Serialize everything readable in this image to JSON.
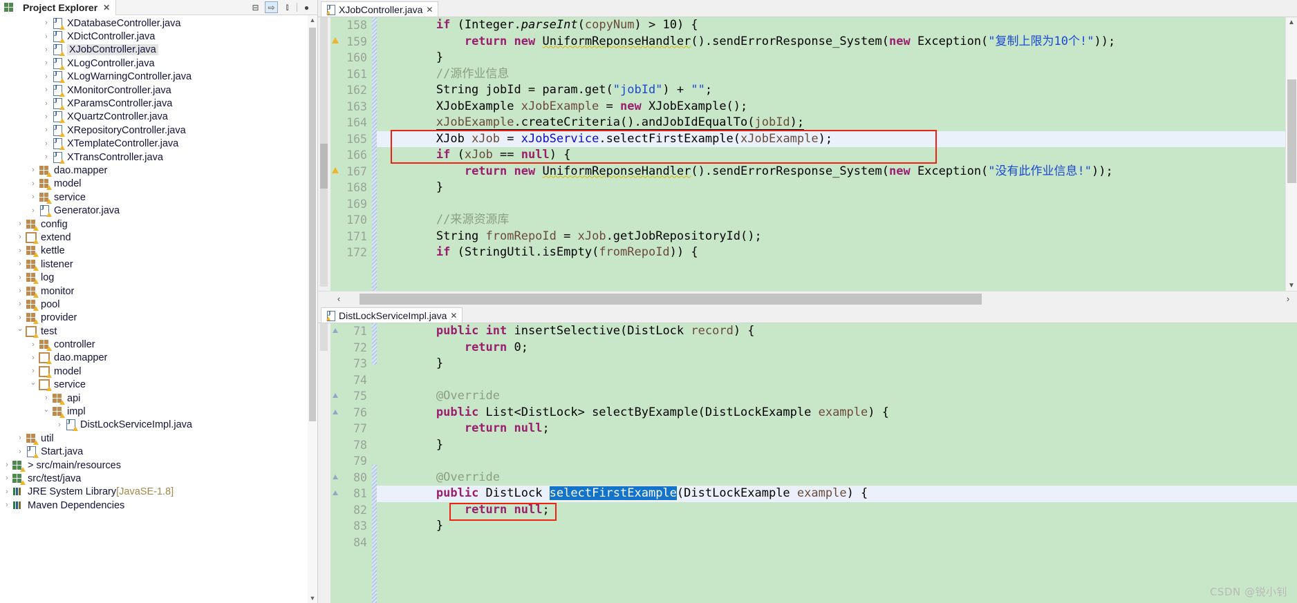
{
  "explorer": {
    "tab_label": "Project Explorer",
    "close_icon": "✕",
    "toolbar": [
      {
        "name": "collapse-all-icon",
        "glyph": "⊟"
      },
      {
        "name": "link-with-editor-icon",
        "glyph": "⇨"
      },
      {
        "name": "view-menu-icon",
        "glyph": "⫾"
      },
      {
        "name": "minimize-icon",
        "glyph": "●"
      }
    ],
    "tree": [
      {
        "label": "XDatabaseController.java",
        "indent": 5,
        "twisty": "closed",
        "icon": "java",
        "warn": true
      },
      {
        "label": "XDictController.java",
        "indent": 5,
        "twisty": "closed",
        "icon": "java",
        "warn": true
      },
      {
        "label": "XJobController.java",
        "indent": 5,
        "twisty": "closed",
        "icon": "java",
        "warn": true,
        "selected": true
      },
      {
        "label": "XLogController.java",
        "indent": 5,
        "twisty": "closed",
        "icon": "java",
        "warn": true
      },
      {
        "label": "XLogWarningController.java",
        "indent": 5,
        "twisty": "closed",
        "icon": "java",
        "warn": true
      },
      {
        "label": "XMonitorController.java",
        "indent": 5,
        "twisty": "closed",
        "icon": "java",
        "warn": true
      },
      {
        "label": "XParamsController.java",
        "indent": 5,
        "twisty": "closed",
        "icon": "java",
        "warn": true
      },
      {
        "label": "XQuartzController.java",
        "indent": 5,
        "twisty": "closed",
        "icon": "java",
        "warn": true
      },
      {
        "label": "XRepositoryController.java",
        "indent": 5,
        "twisty": "closed",
        "icon": "java",
        "warn": true
      },
      {
        "label": "XTemplateController.java",
        "indent": 5,
        "twisty": "closed",
        "icon": "java",
        "warn": true
      },
      {
        "label": "XTransController.java",
        "indent": 5,
        "twisty": "closed",
        "icon": "java",
        "warn": true
      },
      {
        "label": "dao.mapper",
        "indent": 4,
        "twisty": "closed",
        "icon": "pkg",
        "warn": true
      },
      {
        "label": "model",
        "indent": 4,
        "twisty": "closed",
        "icon": "pkg",
        "warn": true
      },
      {
        "label": "service",
        "indent": 4,
        "twisty": "closed",
        "icon": "pkg",
        "warn": true
      },
      {
        "label": "Generator.java",
        "indent": 4,
        "twisty": "closed",
        "icon": "java",
        "warn": true
      },
      {
        "label": "config",
        "indent": 3,
        "twisty": "closed",
        "icon": "pkg",
        "warn": true
      },
      {
        "label": "extend",
        "indent": 3,
        "twisty": "closed",
        "icon": "pkgempty",
        "warn": true
      },
      {
        "label": "kettle",
        "indent": 3,
        "twisty": "closed",
        "icon": "pkg",
        "warn": true
      },
      {
        "label": "listener",
        "indent": 3,
        "twisty": "closed",
        "icon": "pkg",
        "warn": true
      },
      {
        "label": "log",
        "indent": 3,
        "twisty": "closed",
        "icon": "pkg",
        "warn": true
      },
      {
        "label": "monitor",
        "indent": 3,
        "twisty": "closed",
        "icon": "pkg",
        "warn": true
      },
      {
        "label": "pool",
        "indent": 3,
        "twisty": "closed",
        "icon": "pkg",
        "warn": true
      },
      {
        "label": "provider",
        "indent": 3,
        "twisty": "closed",
        "icon": "pkg",
        "warn": true
      },
      {
        "label": "test",
        "indent": 3,
        "twisty": "open",
        "icon": "pkgempty",
        "warn": true
      },
      {
        "label": "controller",
        "indent": 4,
        "twisty": "closed",
        "icon": "pkg",
        "warn": true
      },
      {
        "label": "dao.mapper",
        "indent": 4,
        "twisty": "closed",
        "icon": "pkgempty",
        "warn": true
      },
      {
        "label": "model",
        "indent": 4,
        "twisty": "closed",
        "icon": "pkgempty",
        "warn": true
      },
      {
        "label": "service",
        "indent": 4,
        "twisty": "open",
        "icon": "pkgempty",
        "warn": true
      },
      {
        "label": "api",
        "indent": 5,
        "twisty": "closed",
        "icon": "pkg",
        "warn": true
      },
      {
        "label": "impl",
        "indent": 5,
        "twisty": "open",
        "icon": "pkg",
        "warn": true
      },
      {
        "label": "DistLockServiceImpl.java",
        "indent": 6,
        "twisty": "closed",
        "icon": "java",
        "warn": true
      },
      {
        "label": "util",
        "indent": 3,
        "twisty": "closed",
        "icon": "pkg",
        "warn": true
      },
      {
        "label": "Start.java",
        "indent": 3,
        "twisty": "closed",
        "icon": "java",
        "warn": true
      },
      {
        "label": "> src/main/resources",
        "indent": 2,
        "twisty": "closed",
        "icon": "srcfolder",
        "warn": true
      },
      {
        "label": "src/test/java",
        "indent": 2,
        "twisty": "closed",
        "icon": "srcfolder",
        "warn": true
      },
      {
        "label": "JRE System Library",
        "suffix": " [JavaSE-1.8]",
        "indent": 2,
        "twisty": "closed",
        "icon": "lib",
        "warn": false
      },
      {
        "label": "Maven Dependencies",
        "indent": 2,
        "twisty": "closed",
        "icon": "lib",
        "warn": false
      }
    ]
  },
  "editor_top": {
    "tab_label": "XJobController.java",
    "close_icon": "✕",
    "first_line": 158,
    "lines": [
      {
        "n": 158,
        "segs": [
          {
            "t": "        "
          },
          {
            "t": "if",
            "c": "kw"
          },
          {
            "t": " (Integer."
          },
          {
            "t": "parseInt",
            "c": "mitalic"
          },
          {
            "t": "("
          },
          {
            "t": "copyNum",
            "c": "loc"
          },
          {
            "t": ") > 10) {"
          }
        ]
      },
      {
        "n": 158.1,
        "warn": true,
        "n_disp": 159,
        "segs": [
          {
            "t": "            "
          },
          {
            "t": "return",
            "c": "kw"
          },
          {
            "t": " "
          },
          {
            "t": "new",
            "c": "kw"
          },
          {
            "t": " "
          },
          {
            "t": "UniformReponseHandler",
            "c": "ul-warn"
          },
          {
            "t": "().sendErrorResponse_System("
          },
          {
            "t": "new",
            "c": "kw"
          },
          {
            "t": " Exception("
          },
          {
            "t": "\"复制上限为10个!\"",
            "c": "str"
          },
          {
            "t": "));"
          }
        ]
      },
      {
        "n": 160,
        "segs": [
          {
            "t": "        }"
          }
        ]
      },
      {
        "n": 161,
        "segs": [
          {
            "t": "        //源作业信息",
            "c": "cmt"
          }
        ]
      },
      {
        "n": 162,
        "segs": [
          {
            "t": "        String jobId = param.get("
          },
          {
            "t": "\"jobId\"",
            "c": "str"
          },
          {
            "t": ") + "
          },
          {
            "t": "\"\"",
            "c": "str"
          },
          {
            "t": ";"
          }
        ]
      },
      {
        "n": 163,
        "segs": [
          {
            "t": "        XJobExample "
          },
          {
            "t": "xJobExample",
            "c": "loc"
          },
          {
            "t": " = "
          },
          {
            "t": "new",
            "c": "kw"
          },
          {
            "t": " XJobExample();"
          }
        ]
      },
      {
        "n": 164,
        "segs": [
          {
            "t": "        "
          },
          {
            "t": "xJobExample",
            "c": "loc ul-link"
          },
          {
            "t": ".createCriteria().andJobIdEqualTo(",
            "c": "ul-link"
          },
          {
            "t": "jobId",
            "c": "loc ul-link"
          },
          {
            "t": ");",
            "c": "ul-link"
          }
        ]
      },
      {
        "n": 165,
        "current": true,
        "segs": [
          {
            "t": "        XJob "
          },
          {
            "t": "xJob",
            "c": "loc"
          },
          {
            "t": " = "
          },
          {
            "t": "xJobService",
            "c": "fld"
          },
          {
            "t": ".selectFirstExample("
          },
          {
            "t": "xJobExample",
            "c": "loc"
          },
          {
            "t": ");"
          }
        ]
      },
      {
        "n": 166,
        "segs": [
          {
            "t": "        "
          },
          {
            "t": "if",
            "c": "kw"
          },
          {
            "t": " ("
          },
          {
            "t": "xJob",
            "c": "loc"
          },
          {
            "t": " == "
          },
          {
            "t": "null",
            "c": "kw"
          },
          {
            "t": ") {"
          }
        ]
      },
      {
        "n": 167,
        "warn": true,
        "segs": [
          {
            "t": "            "
          },
          {
            "t": "return",
            "c": "kw"
          },
          {
            "t": " "
          },
          {
            "t": "new",
            "c": "kw"
          },
          {
            "t": " "
          },
          {
            "t": "UniformReponseHandler",
            "c": "ul-warn"
          },
          {
            "t": "().sendErrorResponse_System("
          },
          {
            "t": "new",
            "c": "kw"
          },
          {
            "t": " Exception("
          },
          {
            "t": "\"没有此作业信息!\"",
            "c": "str"
          },
          {
            "t": "));"
          }
        ]
      },
      {
        "n": 168,
        "segs": [
          {
            "t": "        }"
          }
        ]
      },
      {
        "n": 169,
        "segs": [
          {
            "t": ""
          }
        ]
      },
      {
        "n": 170,
        "segs": [
          {
            "t": "        //来源资源库",
            "c": "cmt"
          }
        ]
      },
      {
        "n": 171,
        "segs": [
          {
            "t": "        String "
          },
          {
            "t": "fromRepoId",
            "c": "loc"
          },
          {
            "t": " = "
          },
          {
            "t": "xJob",
            "c": "loc"
          },
          {
            "t": ".getJobRepositoryId();"
          }
        ]
      },
      {
        "n": 172,
        "clipped": true,
        "segs": [
          {
            "t": "        "
          },
          {
            "t": "if",
            "c": "kw"
          },
          {
            "t": " (StringUtil.isEmpty("
          },
          {
            "t": "fromRepoId",
            "c": "loc"
          },
          {
            "t": ")) {"
          }
        ]
      }
    ],
    "hscroll": {
      "left_arrow": "‹",
      "right_arrow": "›"
    }
  },
  "editor_bottom": {
    "tab_label": "DistLockServiceImpl.java",
    "close_icon": "✕",
    "lines": [
      {
        "n": 71,
        "fold": true,
        "segs": [
          {
            "t": "        "
          },
          {
            "t": "public",
            "c": "kw"
          },
          {
            "t": " "
          },
          {
            "t": "int",
            "c": "kw"
          },
          {
            "t": " insertSelective(DistLock "
          },
          {
            "t": "record",
            "c": "loc"
          },
          {
            "t": ") {"
          }
        ]
      },
      {
        "n": 72,
        "segs": [
          {
            "t": "            "
          },
          {
            "t": "return",
            "c": "kw"
          },
          {
            "t": " 0;"
          }
        ]
      },
      {
        "n": 73,
        "segs": [
          {
            "t": "        }"
          }
        ]
      },
      {
        "n": 74,
        "segs": [
          {
            "t": ""
          }
        ]
      },
      {
        "n": 75,
        "fold": true,
        "segs": [
          {
            "t": "        "
          },
          {
            "t": "@Override",
            "c": "anno"
          }
        ]
      },
      {
        "n": 76,
        "fold": true,
        "segs": [
          {
            "t": "        "
          },
          {
            "t": "public",
            "c": "kw"
          },
          {
            "t": " List<DistLock> selectByExample(DistLockExample "
          },
          {
            "t": "example",
            "c": "loc"
          },
          {
            "t": ") {"
          }
        ]
      },
      {
        "n": 77,
        "segs": [
          {
            "t": "            "
          },
          {
            "t": "return",
            "c": "kw"
          },
          {
            "t": " "
          },
          {
            "t": "null",
            "c": "kw"
          },
          {
            "t": ";"
          }
        ]
      },
      {
        "n": 78,
        "segs": [
          {
            "t": "        }"
          }
        ]
      },
      {
        "n": 79,
        "segs": [
          {
            "t": ""
          }
        ]
      },
      {
        "n": 80,
        "fold": true,
        "segs": [
          {
            "t": "        "
          },
          {
            "t": "@Override",
            "c": "anno"
          }
        ]
      },
      {
        "n": 81,
        "fold": true,
        "current": true,
        "segs": [
          {
            "t": "        "
          },
          {
            "t": "public",
            "c": "kw"
          },
          {
            "t": " DistLock "
          },
          {
            "t": "selectFirstExample",
            "c": "selhl"
          },
          {
            "t": "(DistLockExample "
          },
          {
            "t": "example",
            "c": "loc"
          },
          {
            "t": ") {"
          }
        ]
      },
      {
        "n": 82,
        "segs": [
          {
            "t": "            "
          },
          {
            "t": "return",
            "c": "kw"
          },
          {
            "t": " "
          },
          {
            "t": "null",
            "c": "kw"
          },
          {
            "t": ";"
          }
        ]
      },
      {
        "n": 83,
        "segs": [
          {
            "t": "        }"
          }
        ]
      },
      {
        "n": 84,
        "segs": [
          {
            "t": ""
          }
        ]
      }
    ]
  },
  "watermark": "CSDN @锐小钊",
  "colors": {
    "code_background": "#c8e6c8",
    "current_line": "#eaf1fb",
    "selection": "#1273c8",
    "annotation_box": "#ee2211",
    "keyword": "#9b1d6e",
    "string": "#1a49d6",
    "comment": "#8aa07f",
    "field": "#0b0bd0",
    "local_var": "#6b4a3a"
  }
}
